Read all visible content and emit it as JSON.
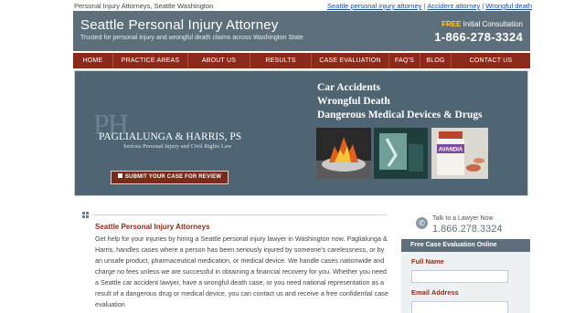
{
  "topbar": {
    "tagline": "Personal Injury Attorneys, Seattle Washington",
    "links": [
      "Seattle personal injury attorney",
      "Accident attorney",
      "Wrongful death"
    ],
    "separator": "|"
  },
  "header": {
    "title": "Seattle Personal Injury Attorney",
    "subtitle": "Trusted for personal injury and wrongful death claims across Washington State",
    "free": "FREE",
    "consultation": " Initial Consultation",
    "phone": "1-866-278-3324"
  },
  "nav": {
    "items": [
      "HOME",
      "PRACTICE AREAS",
      "ABOUT US",
      "RESULTS",
      "CASE EVALUATION",
      "FAQ'S",
      "BLOG",
      "CONTACT US"
    ]
  },
  "banner": {
    "logo_mark": "PH",
    "firm_name": "PAGLIALUNGA & HARRIS, PS",
    "firm_tagline": "Serious Personal Injury and Civil Rights Law",
    "cta": "SUBMIT YOUR CASE FOR REVIEW",
    "headlines": [
      "Car Accidents",
      "Wrongful Death",
      "Dangerous Medical Devices & Drugs"
    ],
    "pill_label": "AVANDIA"
  },
  "content": {
    "title": "Seattle Personal Injury Attorneys",
    "body": "Get help for your injuries by hiring a Seattle personal injury lawyer in Washington now. Paglialunga & Harris, handles cases where a person has been seriously injured by someone's carelessness, or by an unsafe product, pharmaceutical medication, or medical device. We handle cases nationwide and charge no fees unless we are successful in obtaining a financial recovery for you. Whether you need a Seattle car accident lawyer, have a wrongful death case, or you need national representation as a result of a dangerous drug or medical device, you can contact us and receive a free confidential case evaluation"
  },
  "sidebar": {
    "talk_label": "Talk to a Lawyer Now",
    "phone": "1.866.278.3324",
    "form_title": "Free Case Evaluation Online",
    "full_name_label": "Full Name",
    "email_label": "Email Address"
  },
  "colors": {
    "header_slate": "#5d6f7b",
    "nav_red": "#8b2a1a",
    "accent_yellow": "#ffcc33"
  }
}
